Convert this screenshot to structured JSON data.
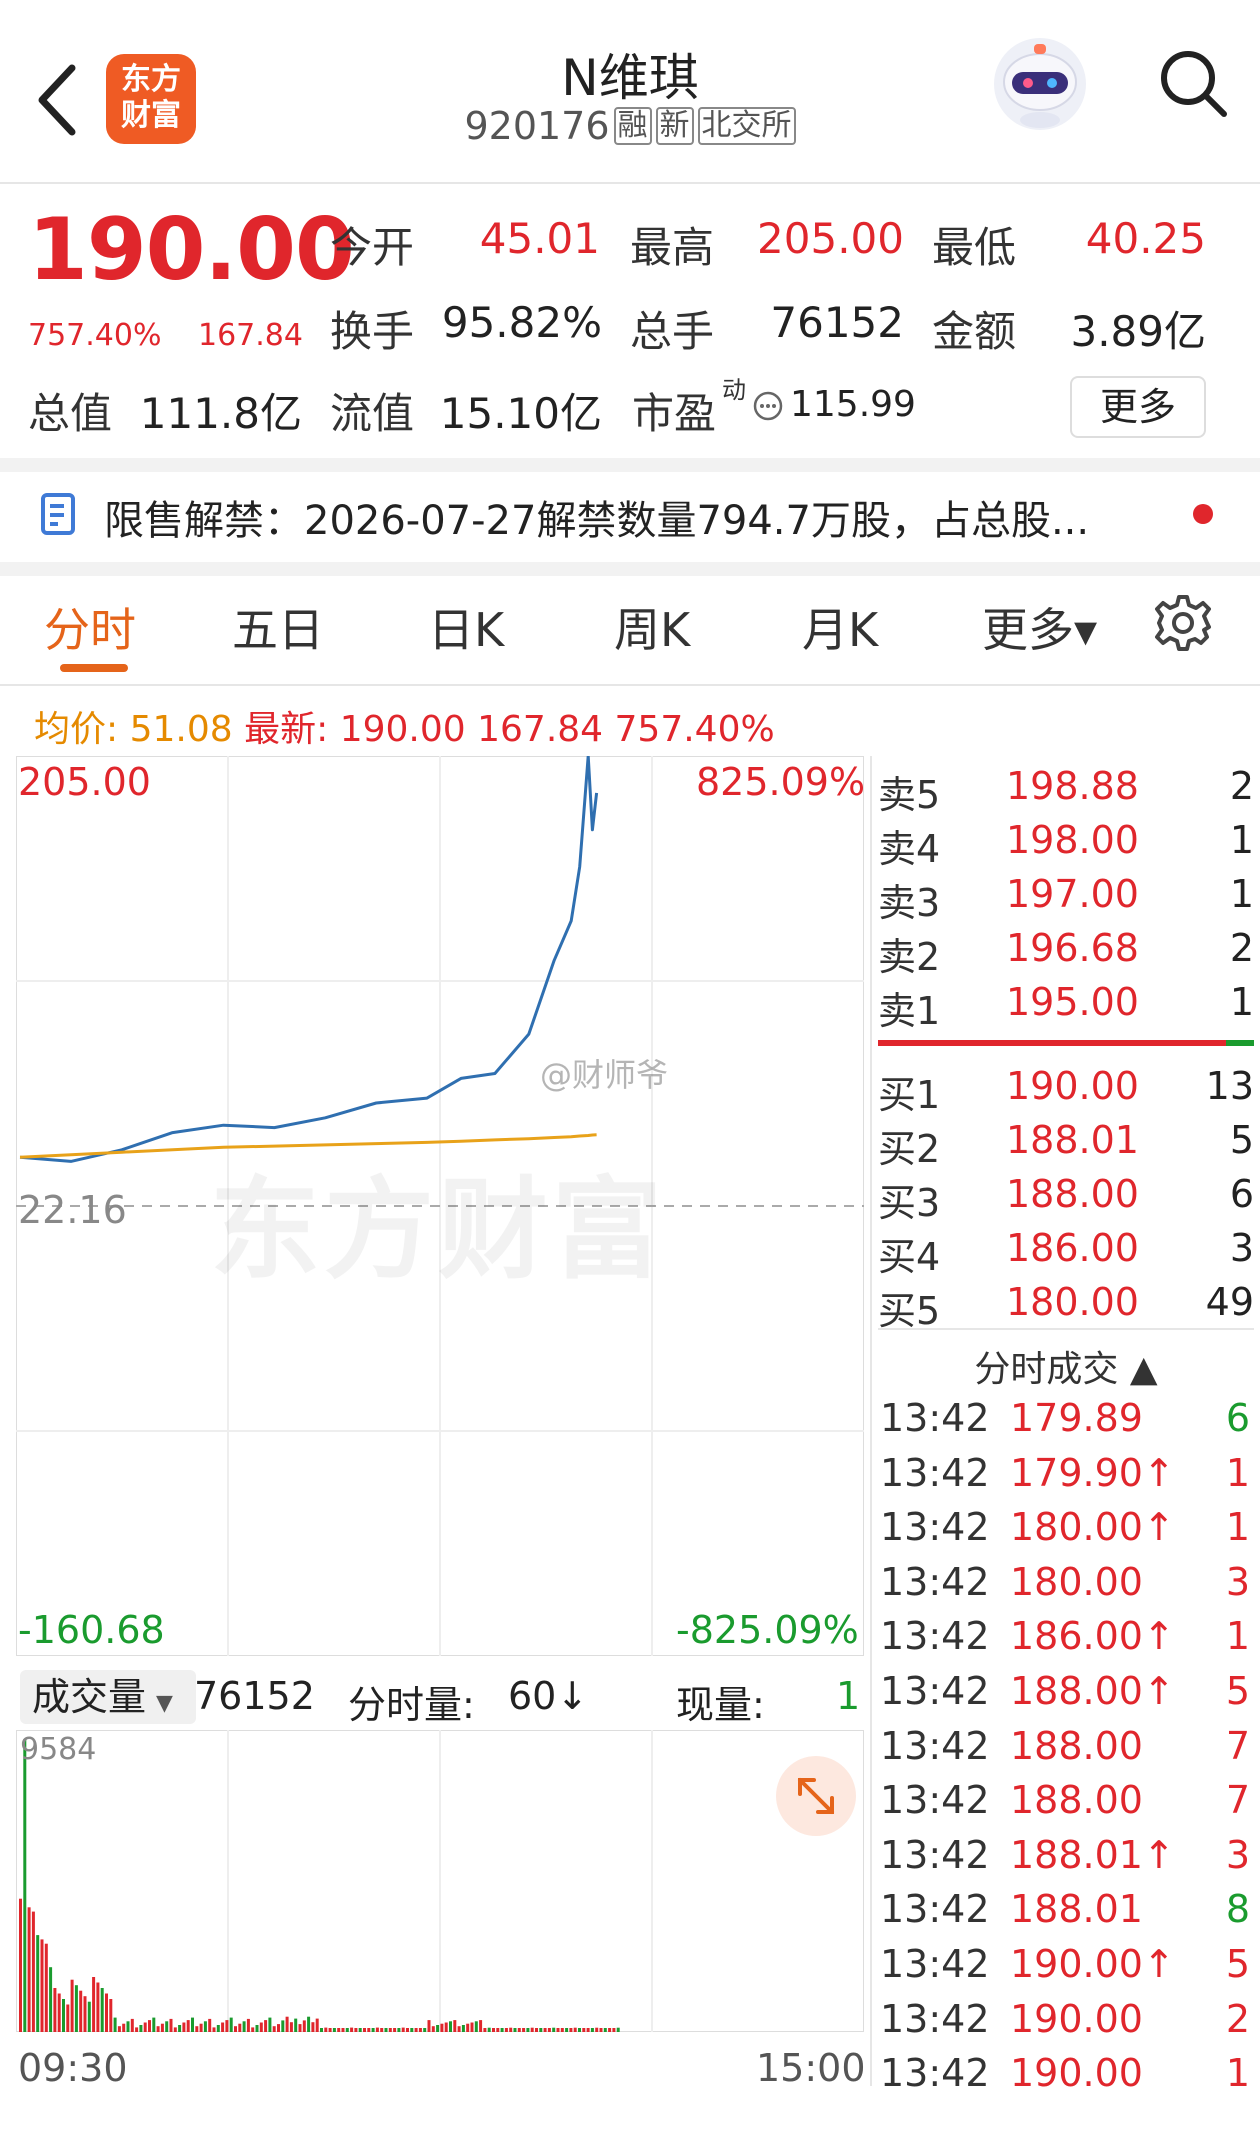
{
  "header": {
    "logo_line1": "东方",
    "logo_line2": "财富",
    "title": "N维琪",
    "code": "920176",
    "tags": [
      "融",
      "新",
      "北交所"
    ]
  },
  "quote": {
    "price": "190.00",
    "change_pct": "757.40%",
    "change": "167.84",
    "open_label": "今开",
    "open": "45.01",
    "high_label": "最高",
    "high": "205.00",
    "low_label": "最低",
    "low": "40.25",
    "turnover_label": "换手",
    "turnover": "95.82%",
    "volume_label": "总手",
    "volume": "76152",
    "amount_label": "金额",
    "amount": "3.89亿",
    "mktcap_label": "总值",
    "mktcap": "111.8亿",
    "float_label": "流值",
    "float": "15.10亿",
    "pe_label": "市盈",
    "pe_sup": "动",
    "pe": "115.99",
    "more_label": "更多"
  },
  "notice": {
    "text": "限售解禁：2026-07-27解禁数量794.7万股，占总股..."
  },
  "tabs": [
    "分时",
    "五日",
    "日K",
    "周K",
    "月K",
    "更多▾"
  ],
  "active_tab": 0,
  "summary": {
    "avg_label": "均价:",
    "avg": "51.08",
    "latest_label": "最新:",
    "latest": "190.00 167.84 757.40%"
  },
  "chart_labels": {
    "top_left": "205.00",
    "top_right": "825.09%",
    "mid_left": "22.16",
    "bottom_left": "-160.68",
    "bottom_right": "-825.09%",
    "time_start": "09:30",
    "time_end": "15:00",
    "watermark": "东方财富",
    "weibo": "@财师爷"
  },
  "volume_bar": {
    "selector": "成交量",
    "total": "76152",
    "minute_label": "分时量:",
    "minute_value": "60↓",
    "current_label": "现量:",
    "current_value": "1",
    "max_label": "9584"
  },
  "order_book": {
    "asks": [
      {
        "label": "卖5",
        "price": "198.88",
        "qty": "2"
      },
      {
        "label": "卖4",
        "price": "198.00",
        "qty": "1"
      },
      {
        "label": "卖3",
        "price": "197.00",
        "qty": "1"
      },
      {
        "label": "卖2",
        "price": "196.68",
        "qty": "2"
      },
      {
        "label": "卖1",
        "price": "195.00",
        "qty": "1"
      }
    ],
    "bids": [
      {
        "label": "买1",
        "price": "190.00",
        "qty": "13"
      },
      {
        "label": "买2",
        "price": "188.01",
        "qty": "5"
      },
      {
        "label": "买3",
        "price": "188.00",
        "qty": "6"
      },
      {
        "label": "买4",
        "price": "186.00",
        "qty": "3"
      },
      {
        "label": "买5",
        "price": "180.00",
        "qty": "49"
      }
    ]
  },
  "trades": {
    "header": "分时成交 ▲",
    "rows": [
      {
        "time": "13:42",
        "price": "179.89",
        "qty": "6",
        "up": false,
        "color": "green"
      },
      {
        "time": "13:42",
        "price": "179.90↑",
        "qty": "1",
        "up": true,
        "color": "red"
      },
      {
        "time": "13:42",
        "price": "180.00↑",
        "qty": "1",
        "up": true,
        "color": "red"
      },
      {
        "time": "13:42",
        "price": "180.00",
        "qty": "3",
        "up": false,
        "color": "red"
      },
      {
        "time": "13:42",
        "price": "186.00↑",
        "qty": "1",
        "up": true,
        "color": "red"
      },
      {
        "time": "13:42",
        "price": "188.00↑",
        "qty": "5",
        "up": true,
        "color": "red"
      },
      {
        "time": "13:42",
        "price": "188.00",
        "qty": "7",
        "up": false,
        "color": "red"
      },
      {
        "time": "13:42",
        "price": "188.00",
        "qty": "7",
        "up": false,
        "color": "red"
      },
      {
        "time": "13:42",
        "price": "188.01↑",
        "qty": "3",
        "up": true,
        "color": "red"
      },
      {
        "time": "13:42",
        "price": "188.01",
        "qty": "8",
        "up": false,
        "color": "green"
      },
      {
        "time": "13:42",
        "price": "190.00↑",
        "qty": "5",
        "up": true,
        "color": "red"
      },
      {
        "time": "13:42",
        "price": "190.00",
        "qty": "2",
        "up": false,
        "color": "red"
      },
      {
        "time": "13:42",
        "price": "190.00",
        "qty": "1",
        "up": false,
        "color": "red"
      }
    ]
  },
  "colors": {
    "up": "#e0262c",
    "down": "#1a9b2e",
    "price_line": "#2f6fb0",
    "avg_line": "#e8a21a",
    "accent": "#e5641a"
  },
  "chart_data": {
    "type": "line",
    "title": "",
    "x": [
      "09:30",
      "09:45",
      "10:00",
      "10:15",
      "10:30",
      "10:45",
      "11:00",
      "11:15",
      "11:30",
      "13:00",
      "13:10",
      "13:20",
      "13:30",
      "13:35",
      "13:38",
      "13:40",
      "13:41",
      "13:42"
    ],
    "series": [
      {
        "values": [
          42,
          40.3,
          45,
          52,
          55,
          54,
          58,
          64,
          66,
          74,
          76,
          92,
          122,
          138,
          160,
          205,
          175,
          190
        ]
      },
      {
        "values": [
          42,
          43,
          44,
          45,
          46,
          46.5,
          47,
          47.5,
          48,
          48.5,
          49,
          49.5,
          50,
          50.3,
          50.6,
          50.8,
          51,
          51.08
        ]
      }
    ],
    "ylim": [
      -160.68,
      205.0
    ],
    "prev_close": 22.16,
    "volume_max": 9584
  }
}
